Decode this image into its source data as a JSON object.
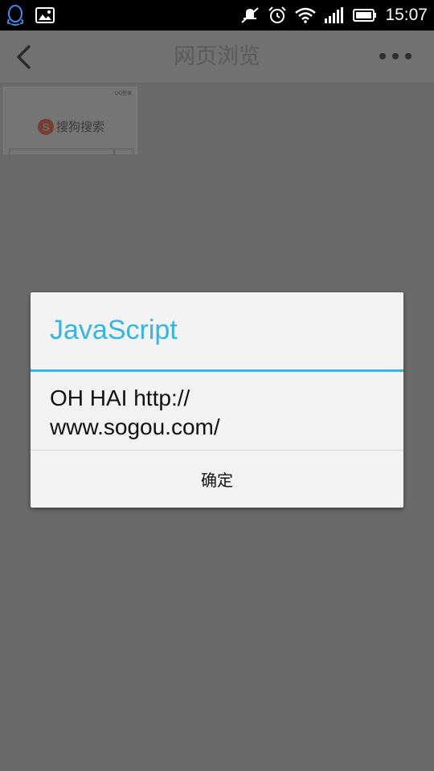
{
  "status_bar": {
    "time": "15:07",
    "left_icons": [
      "qq-icon",
      "image-icon"
    ],
    "right_icons": [
      "mute-icon",
      "alarm-icon",
      "wifi-icon",
      "signal-icon",
      "battery-icon"
    ]
  },
  "header": {
    "title": "网页浏览",
    "back_icon": "chevron-left-icon",
    "more_icon": "more-icon"
  },
  "thumbnail": {
    "login_text": "QQ登录",
    "logo_letter": "S",
    "logo_text": "搜狗搜索"
  },
  "dialog": {
    "title": "JavaScript",
    "message": "OH HAI http://\nwww.sogou.com/",
    "ok_label": "确定"
  },
  "colors": {
    "accent": "#33b5e5",
    "overlay": "#6a6a6a"
  }
}
